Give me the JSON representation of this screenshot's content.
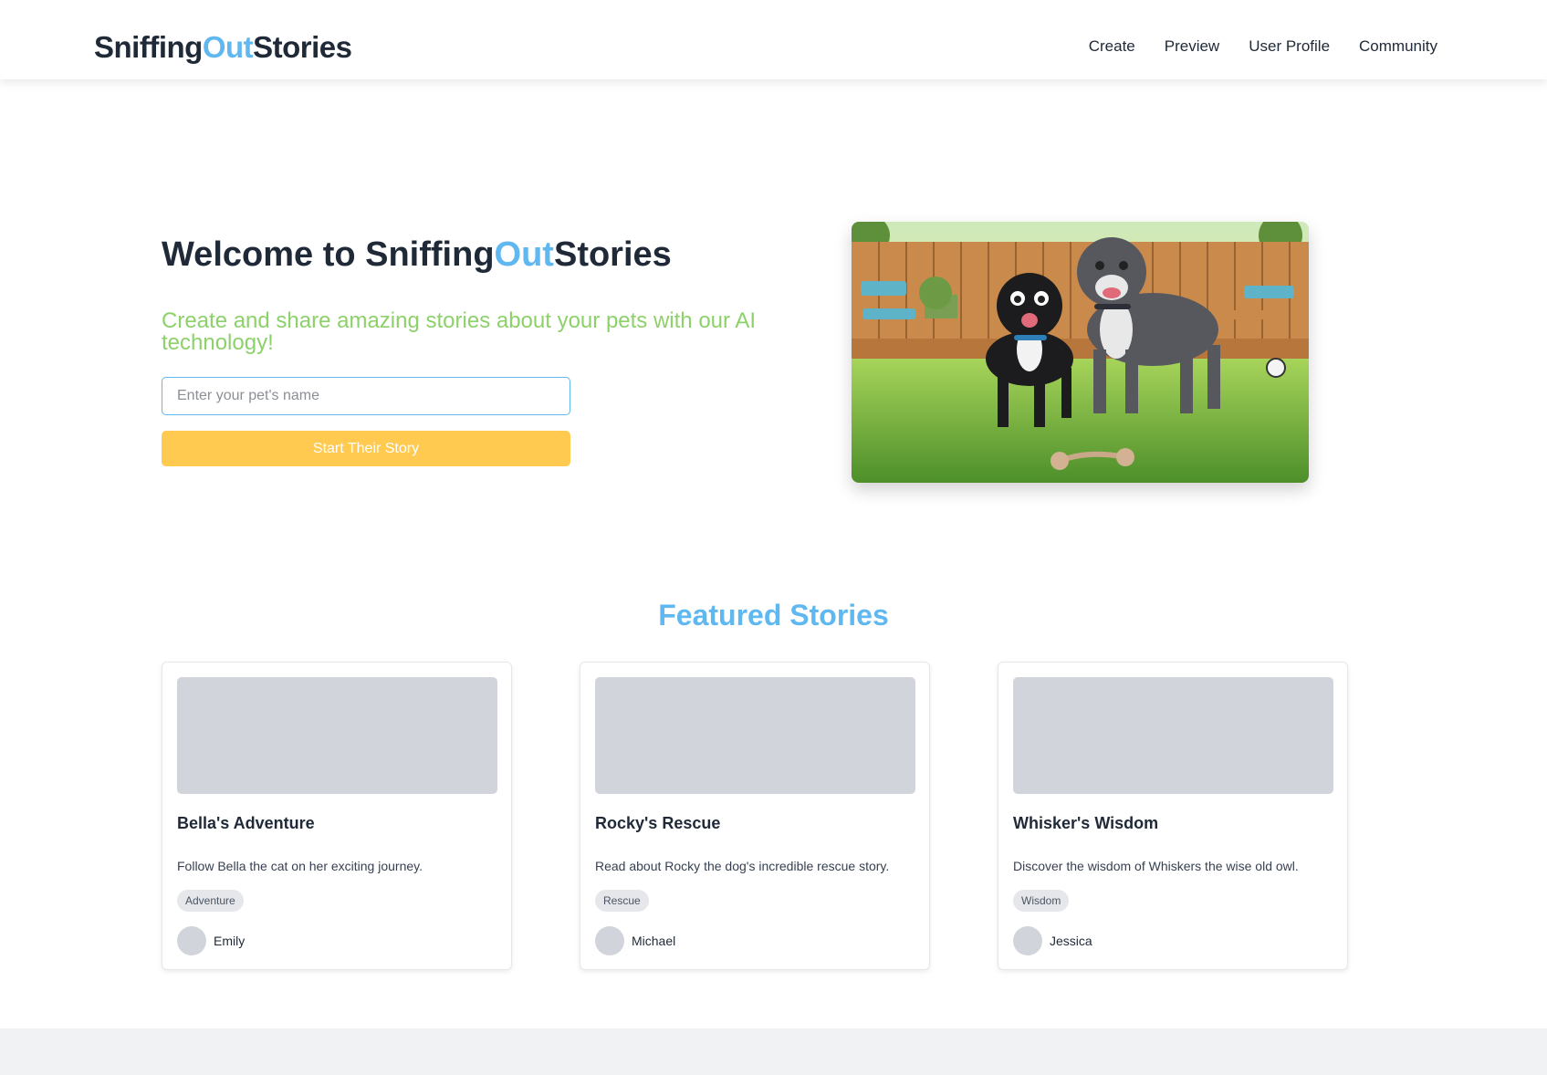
{
  "header": {
    "logo": {
      "part1": "Sniffing",
      "part2": "Out",
      "part3": "Stories"
    },
    "nav": [
      "Create",
      "Preview",
      "User Profile",
      "Community"
    ]
  },
  "hero": {
    "title_prefix": "Welcome to ",
    "title_brand": {
      "part1": "Sniffing",
      "part2": "Out",
      "part3": "Stories"
    },
    "subtitle": "Create and share amazing stories about your pets with our AI technology!",
    "input_placeholder": "Enter your pet's name",
    "input_value": "",
    "button_label": "Start Their Story"
  },
  "featured": {
    "title": "Featured Stories",
    "stories": [
      {
        "title": "Bella's Adventure",
        "description": "Follow Bella the cat on her exciting journey.",
        "tag": "Adventure",
        "author": "Emily"
      },
      {
        "title": "Rocky's Rescue",
        "description": "Read about Rocky the dog's incredible rescue story.",
        "tag": "Rescue",
        "author": "Michael"
      },
      {
        "title": "Whisker's Wisdom",
        "description": "Discover the wisdom of Whiskers the wise old owl.",
        "tag": "Wisdom",
        "author": "Jessica"
      }
    ]
  },
  "colors": {
    "accent": "#60b8f0",
    "subtitle_green": "#8dd16a",
    "button_yellow": "#ffca4f",
    "text_dark": "#1f2937",
    "placeholder_gray": "#d1d5db"
  }
}
